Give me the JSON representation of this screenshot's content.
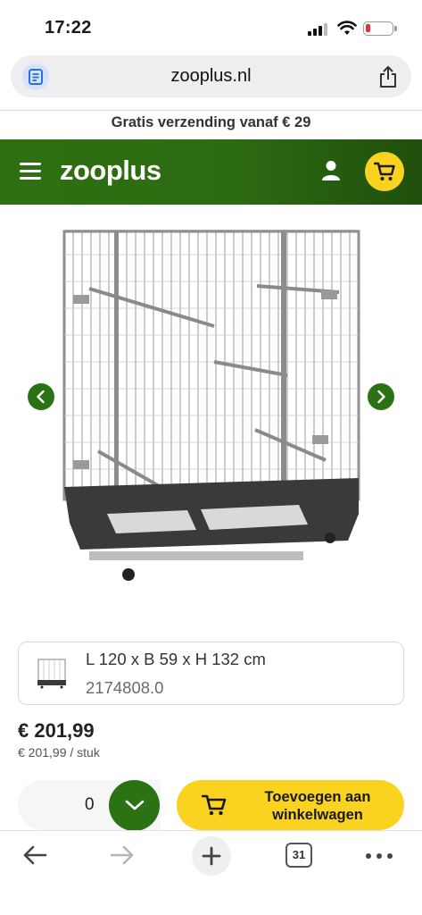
{
  "status_bar": {
    "time": "17:22"
  },
  "browser": {
    "url": "zooplus.nl",
    "tabs_count": "31"
  },
  "promo_text": "Gratis verzending vanaf € 29",
  "header": {
    "logo_text": "zooplus",
    "brand_green": "#2e7011",
    "accent_yellow": "#f9d31f"
  },
  "product": {
    "variant": {
      "dimensions": "L 120 x B 59 x H 132 cm",
      "sku": "2174808.0"
    },
    "price": "€ 201,99",
    "unit_price": "€ 201,99 / stuk",
    "quantity": "0",
    "add_to_cart_line1": "Toevoegen aan",
    "add_to_cart_line2": "winkelwagen"
  },
  "icons": [
    "page-icon",
    "share-icon",
    "menu-icon",
    "user-icon",
    "cart-icon",
    "chevron-left-icon",
    "chevron-right-icon",
    "chevron-down-icon",
    "back-icon",
    "forward-icon",
    "plus-icon",
    "tabs-icon",
    "more-icon"
  ]
}
